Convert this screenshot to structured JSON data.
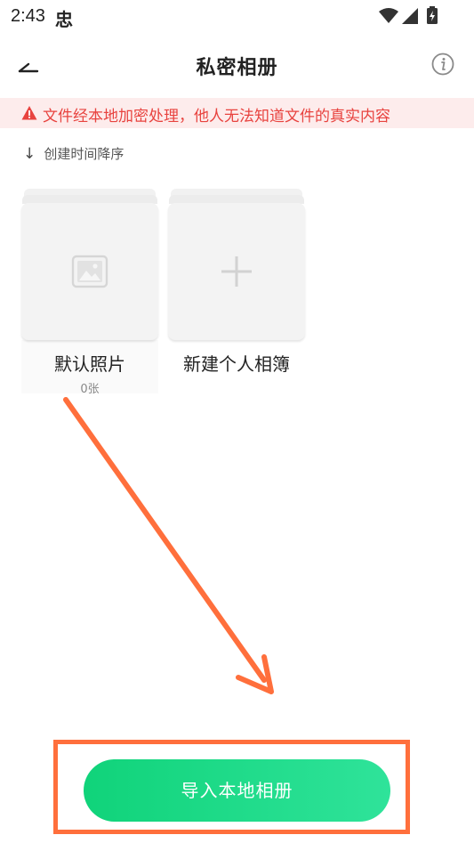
{
  "status_bar": {
    "time": "2:43",
    "app_icon_glyph": "忠",
    "wifi_icon": "wifi-icon",
    "signal_icon": "signal-icon",
    "battery_icon": "battery-charging-icon"
  },
  "header": {
    "title": "私密相册",
    "back_icon": "back-arrow-icon",
    "info_icon": "info-icon"
  },
  "warning": {
    "icon": "warning-triangle-icon",
    "text": "文件经本地加密处理，他人无法知道文件的真实内容",
    "color": "#e8433f",
    "background": "#fdecec"
  },
  "sort": {
    "arrow": "↓",
    "label": "创建时间降序"
  },
  "albums": [
    {
      "name": "默认照片",
      "count": "0张",
      "icon": "image-placeholder-icon"
    },
    {
      "name": "新建个人相簿",
      "icon": "plus-icon"
    }
  ],
  "import_button": {
    "label": "导入本地相册",
    "color_start": "#10d37a",
    "color_end": "#2fe39a"
  },
  "annotation": {
    "color": "#ff6f3c"
  }
}
